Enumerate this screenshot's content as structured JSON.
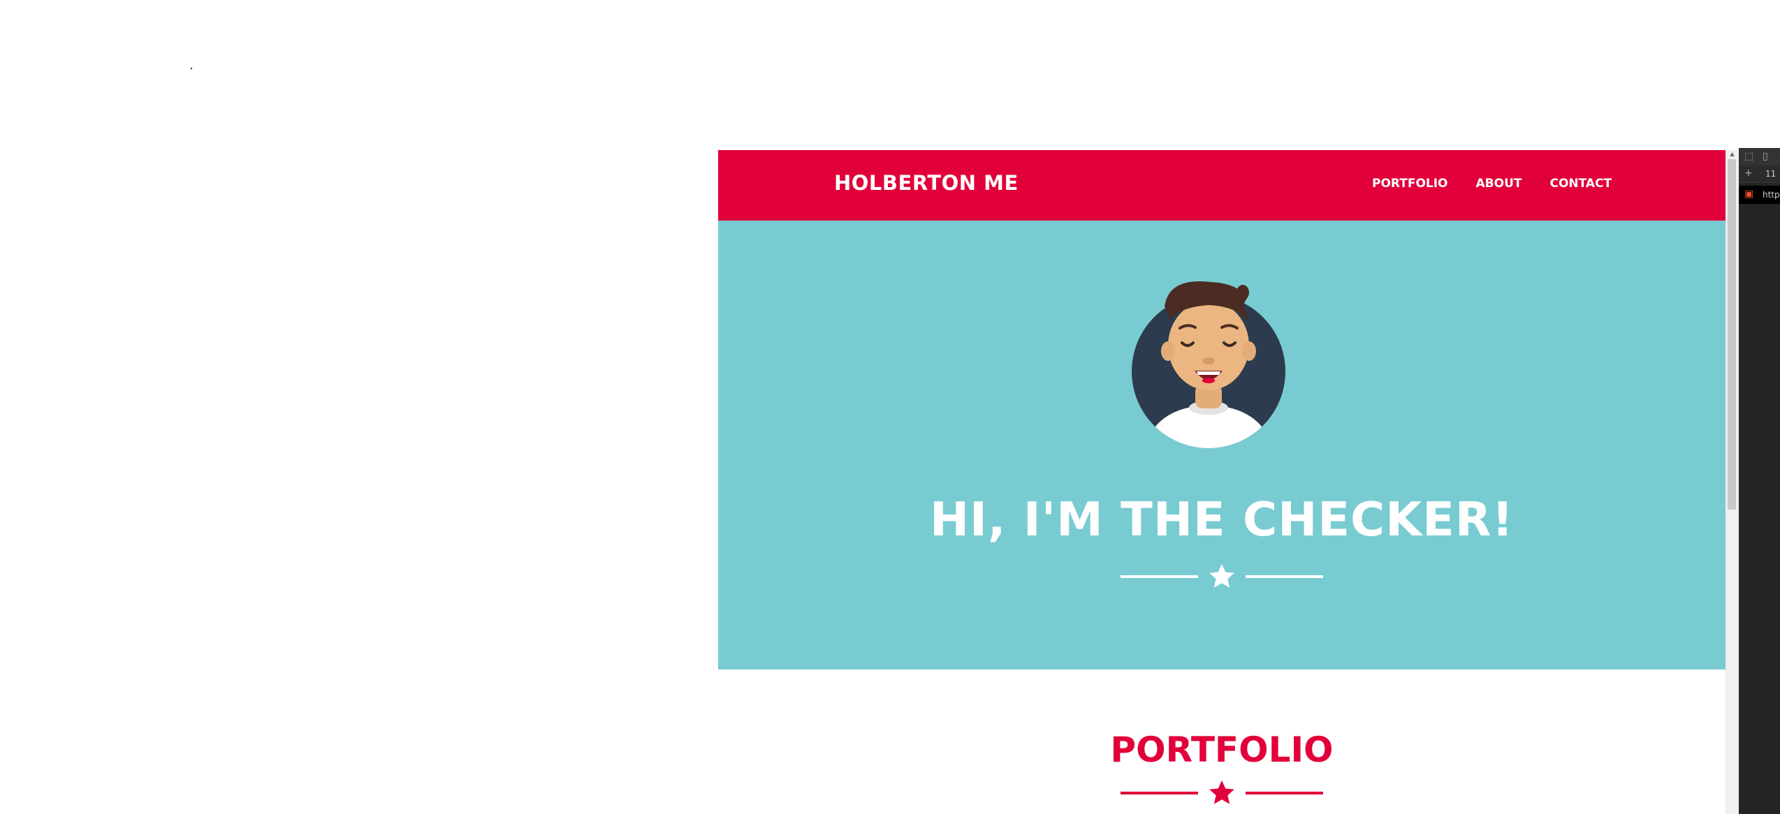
{
  "navbar": {
    "brand": "HOLBERTON ME",
    "links": [
      "PORTFOLIO",
      "ABOUT",
      "CONTACT"
    ]
  },
  "hero": {
    "title": "HI, I'M THE CHECKER!"
  },
  "portfolio": {
    "title": "PORTFOLIO"
  },
  "devtools": {
    "zoom_text": "11",
    "url_text": "http"
  },
  "colors": {
    "brand_red": "#e1003a",
    "hero_teal": "#78ccd1",
    "avatar_bg": "#2d3b4e"
  },
  "icons": {
    "divider_star": "star-icon",
    "avatar": "checker-avatar"
  }
}
